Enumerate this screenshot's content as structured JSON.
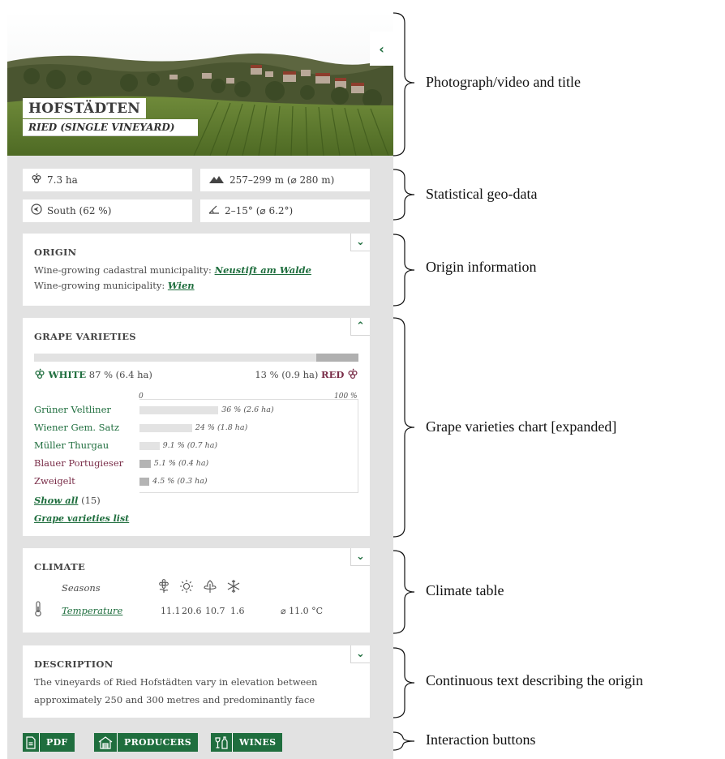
{
  "header": {
    "title": "HOFSTÄDTEN",
    "subtitle": "RIED (SINGLE VINEYARD)",
    "collapse_icon": "chevron-left-icon"
  },
  "stats": {
    "area": "7.3 ha",
    "elevation": "257–299 m (⌀ 280 m)",
    "aspect": "South (62 %)",
    "slope": "2–15° (⌀ 6.2°)"
  },
  "origin": {
    "heading": "ORIGIN",
    "cadastral_label": "Wine-growing cadastral municipality:",
    "cadastral_value": "Neustift am Walde",
    "municipality_label": "Wine-growing municipality:",
    "municipality_value": "Wien"
  },
  "grapes": {
    "heading": "GRAPE VARIETIES",
    "white_label": "WHITE",
    "white_value": "87 % (6.4 ha)",
    "red_value": "13 % (0.9 ha)",
    "red_label": "RED",
    "white_share": 0.87,
    "red_share": 0.13,
    "axis_min": "0",
    "axis_max": "100 %",
    "varieties": [
      {
        "name": "Grüner Veltliner",
        "label": "36 % (2.6 ha)",
        "share": 36,
        "color": "white"
      },
      {
        "name": "Wiener Gem. Satz",
        "label": "24 % (1.8 ha)",
        "share": 24,
        "color": "white"
      },
      {
        "name": "Müller Thurgau",
        "label": "9.1 % (0.7 ha)",
        "share": 9.1,
        "color": "white"
      },
      {
        "name": "Blauer Portugieser",
        "label": "5.1 % (0.4 ha)",
        "share": 5.1,
        "color": "red"
      },
      {
        "name": "Zweigelt",
        "label": "4.5 % (0.3 ha)",
        "share": 4.5,
        "color": "red"
      }
    ],
    "show_all": "Show all",
    "show_all_count": "(15)",
    "list_link": "Grape varieties list"
  },
  "climate": {
    "heading": "CLIMATE",
    "seasons_label": "Seasons",
    "temperature_label": "Temperature",
    "values": [
      "11.1",
      "20.6",
      "10.7",
      "1.6"
    ],
    "average": "⌀ 11.0 °C",
    "season_icons": [
      "spring-flower-icon",
      "summer-sun-icon",
      "autumn-leaf-icon",
      "winter-snowflake-icon"
    ]
  },
  "description": {
    "heading": "DESCRIPTION",
    "line1": "The vineyards of Ried Hofstädten vary in elevation between",
    "line2": "approximately 250 and 300 metres and predominantly face"
  },
  "buttons": {
    "pdf": "PDF",
    "producers": "PRODUCERS",
    "wines": "WINES"
  },
  "annotations": {
    "hero": "Photograph/video and title",
    "stats": "Statistical geo-data",
    "origin": "Origin information",
    "grapes": "Grape varieties chart [expanded]",
    "climate": "Climate table",
    "description": "Continuous text describing the origin",
    "buttons": "Interaction buttons"
  },
  "colors": {
    "brand_green": "#1f6e3e",
    "red_wine": "#7a2e49",
    "panel_bg": "#e2e2e2"
  }
}
